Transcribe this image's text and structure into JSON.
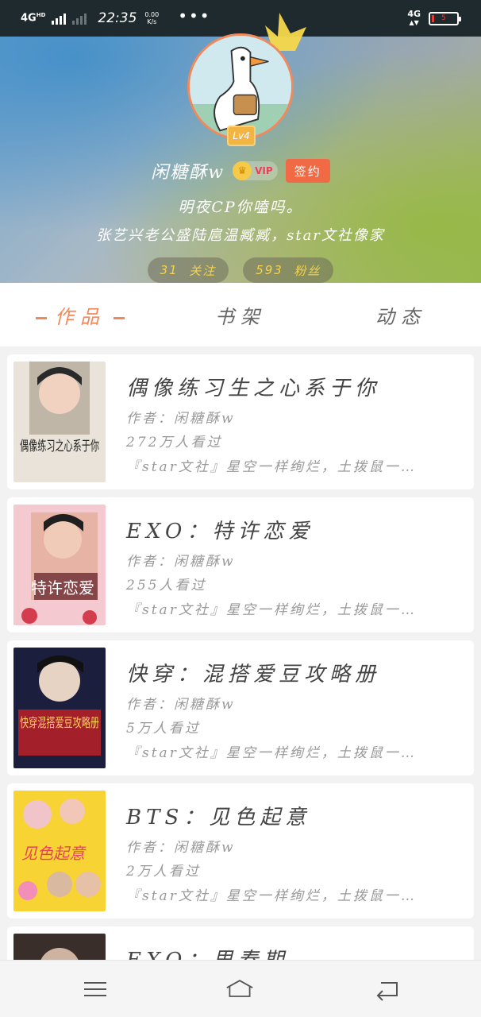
{
  "status_bar": {
    "network": "4G",
    "network_sup": "HD",
    "time": "22:35",
    "speed_value": "0.00",
    "speed_unit": "K/s",
    "more": "•••",
    "network_right": "4G",
    "battery_text": "5"
  },
  "profile": {
    "level": "Lv4",
    "username": "闲糖酥w",
    "vip_label": "VIP",
    "signed_label": "签约",
    "bio_line1": "明夜CP你嗑吗。",
    "bio_line2": "张艺兴老公盛陆扈温臧臧，star文社像家",
    "following_count": "31",
    "following_label": "关注",
    "fans_count": "593",
    "fans_label": "粉丝"
  },
  "tabs": [
    {
      "label": "作品",
      "active": true
    },
    {
      "label": "书架",
      "active": false
    },
    {
      "label": "动态",
      "active": false
    }
  ],
  "books": [
    {
      "title": "偶像练习生之心系于你",
      "author": "作者：闲糖酥w",
      "views": "272万人看过",
      "desc": "『star文社』星空一样绚烂，土拨鼠一…",
      "cover_text": "偶像练习之心系于你"
    },
    {
      "title": "EXO：特许恋爱",
      "author": "作者：闲糖酥w",
      "views": "255人看过",
      "desc": "『star文社』星空一样绚烂，土拨鼠一…",
      "cover_text": "特许恋爱"
    },
    {
      "title": "快穿：混搭爱豆攻略册",
      "author": "作者：闲糖酥w",
      "views": "5万人看过",
      "desc": "『star文社』星空一样绚烂，土拨鼠一…",
      "cover_text": "快穿混搭爱豆攻略册"
    },
    {
      "title": "BTS：见色起意",
      "author": "作者：闲糖酥w",
      "views": "2万人看过",
      "desc": "『star文社』星空一样绚烂，土拨鼠一…",
      "cover_text": "见色起意"
    },
    {
      "title": "EXO：思春期",
      "author": "",
      "views": "",
      "desc": "",
      "cover_text": ""
    }
  ],
  "colors": {
    "accent": "#f08a5d",
    "signed": "#f06a45",
    "level": "#f2b544",
    "stat_text": "#f6d24c"
  },
  "nav": {
    "menu_icon": "menu-icon",
    "home_icon": "home-icon",
    "back_icon": "back-icon"
  }
}
